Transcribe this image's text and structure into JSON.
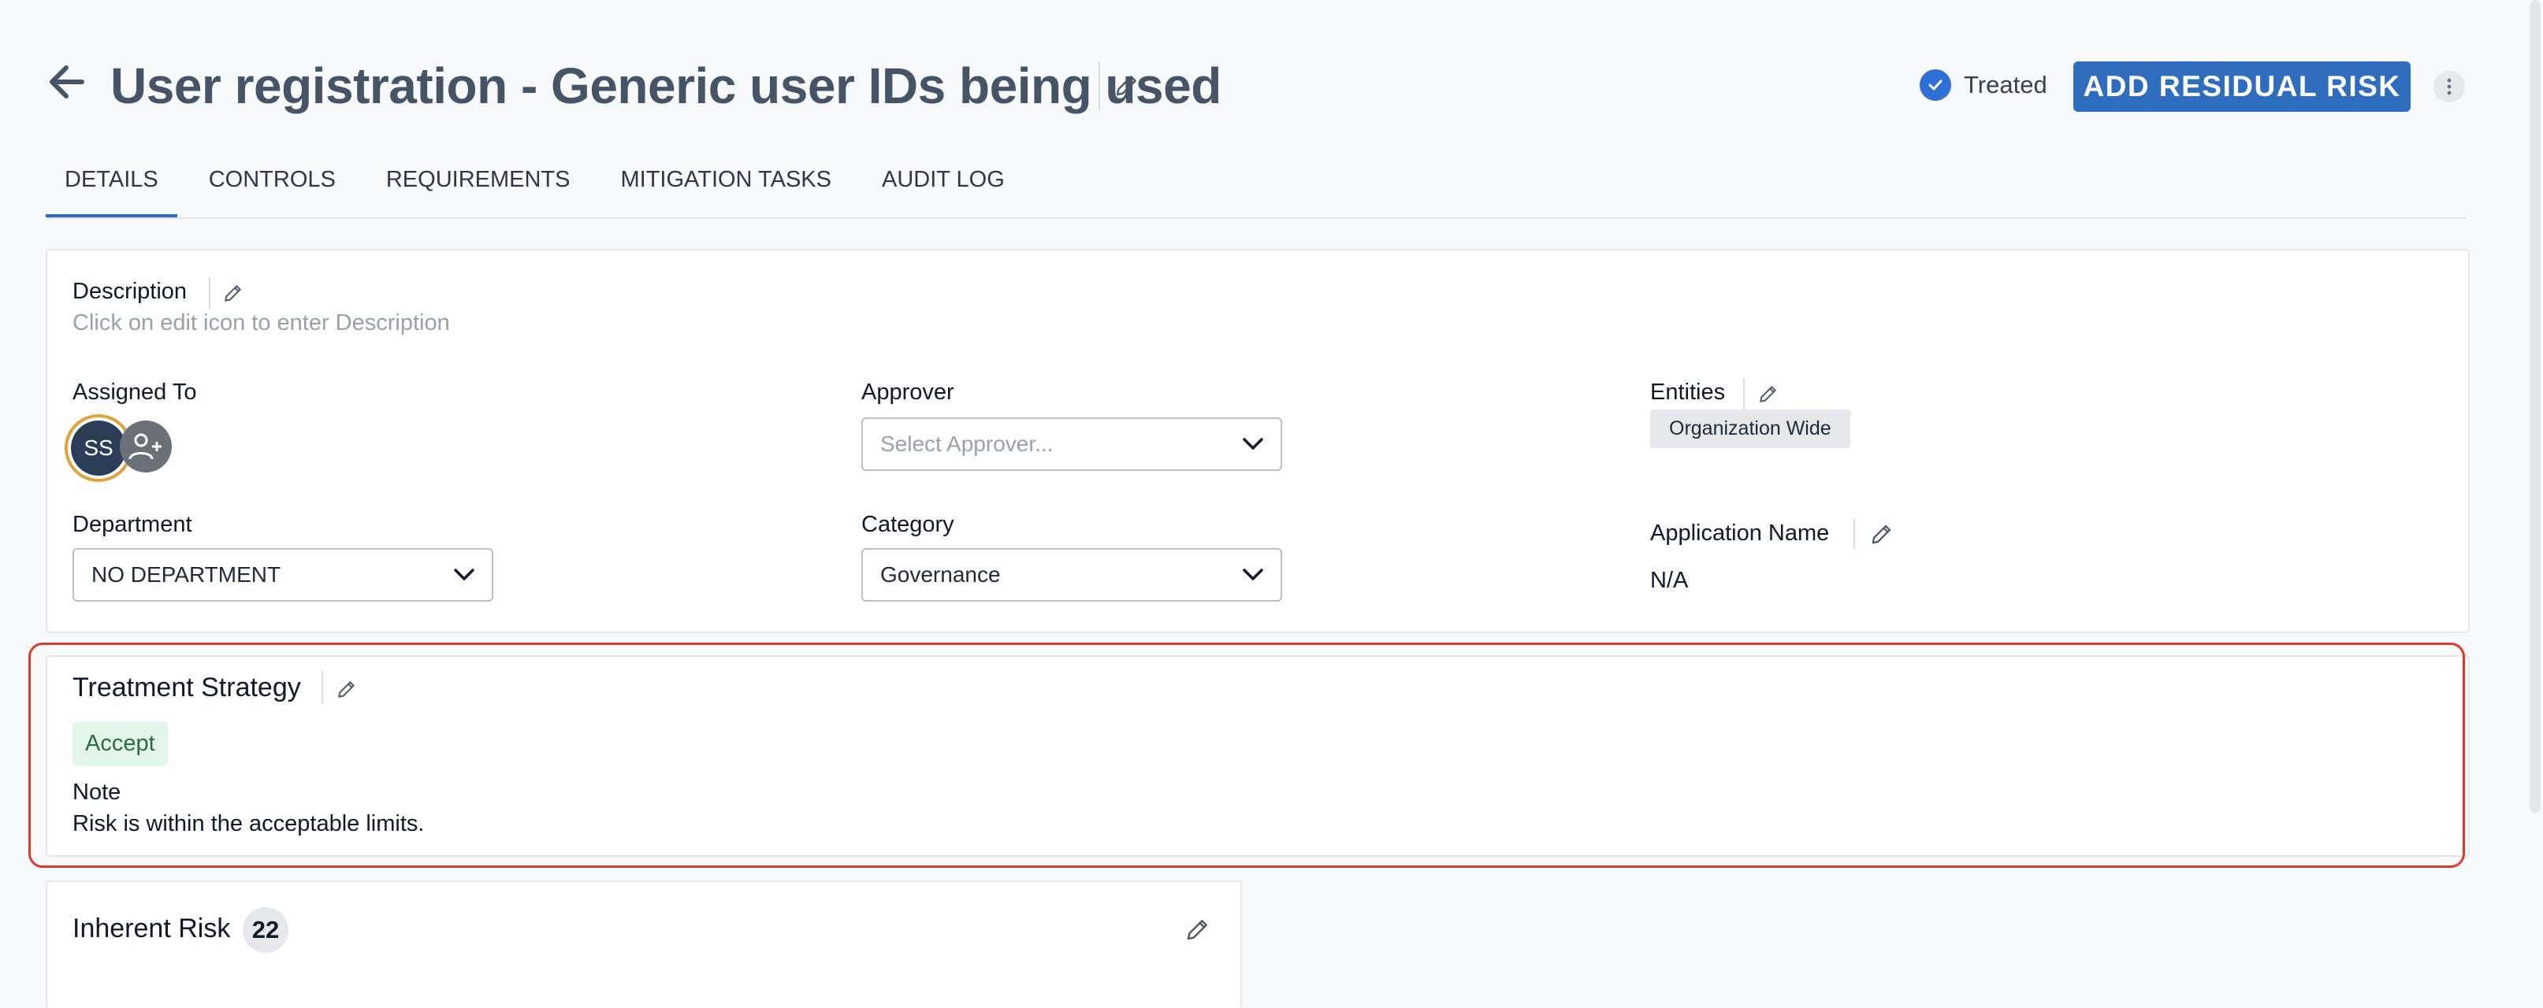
{
  "header": {
    "title": "User registration - Generic user IDs being used",
    "status_label": "Treated",
    "add_button_label": "ADD RESIDUAL RISK"
  },
  "tabs": [
    {
      "label": "DETAILS",
      "active": true
    },
    {
      "label": "CONTROLS",
      "active": false
    },
    {
      "label": "REQUIREMENTS",
      "active": false
    },
    {
      "label": "MITIGATION TASKS",
      "active": false
    },
    {
      "label": "AUDIT LOG",
      "active": false
    }
  ],
  "details": {
    "description_label": "Description",
    "description_placeholder": "Click on edit icon to enter Description",
    "assigned_to_label": "Assigned To",
    "assignee_initials": "SS",
    "approver_label": "Approver",
    "approver_placeholder": "Select Approver...",
    "entities_label": "Entities",
    "entities_tag": "Organization Wide",
    "department_label": "Department",
    "department_value": "NO DEPARTMENT",
    "category_label": "Category",
    "category_value": "Governance",
    "application_name_label": "Application Name",
    "application_name_value": "N/A"
  },
  "treatment": {
    "title": "Treatment Strategy",
    "strategy": "Accept",
    "note_label": "Note",
    "note_text": "Risk is within the acceptable limits."
  },
  "inherent_risk": {
    "title": "Inherent Risk",
    "score": "22"
  },
  "colors": {
    "accent": "#2e6dbd",
    "highlight_border": "#e0392b",
    "accept_bg": "#e2f6e9"
  },
  "icons": [
    "arrow-left-icon",
    "pencil-icon",
    "check-circle-icon",
    "more-vertical-icon",
    "chevron-down-icon",
    "user-add-icon"
  ]
}
